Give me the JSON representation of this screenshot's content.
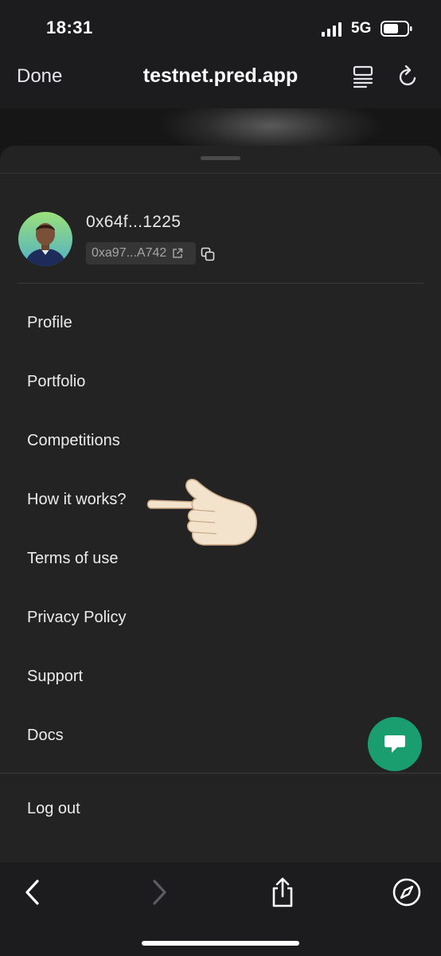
{
  "status": {
    "time": "18:31",
    "network": "5G"
  },
  "browser": {
    "done_label": "Done",
    "url": "testnet.pred.app"
  },
  "account": {
    "name": "0x64f...1225",
    "address": "0xa97...A742"
  },
  "menu": {
    "items": [
      {
        "label": "Profile"
      },
      {
        "label": "Portfolio"
      },
      {
        "label": "Competitions"
      },
      {
        "label": "How it works?"
      },
      {
        "label": "Terms of use"
      },
      {
        "label": "Privacy Policy"
      },
      {
        "label": "Support"
      },
      {
        "label": "Docs"
      }
    ],
    "logout_label": "Log out"
  },
  "colors": {
    "accent": "#1a9e70",
    "sheet": "#232323",
    "chrome": "#1c1c1e"
  },
  "icons": [
    "signal-icon",
    "battery-icon",
    "reader-mode-icon",
    "reload-icon",
    "external-link-icon",
    "copy-icon",
    "pointing-hand-emoji",
    "chat-icon",
    "back-icon",
    "forward-icon",
    "share-icon",
    "compass-icon"
  ]
}
